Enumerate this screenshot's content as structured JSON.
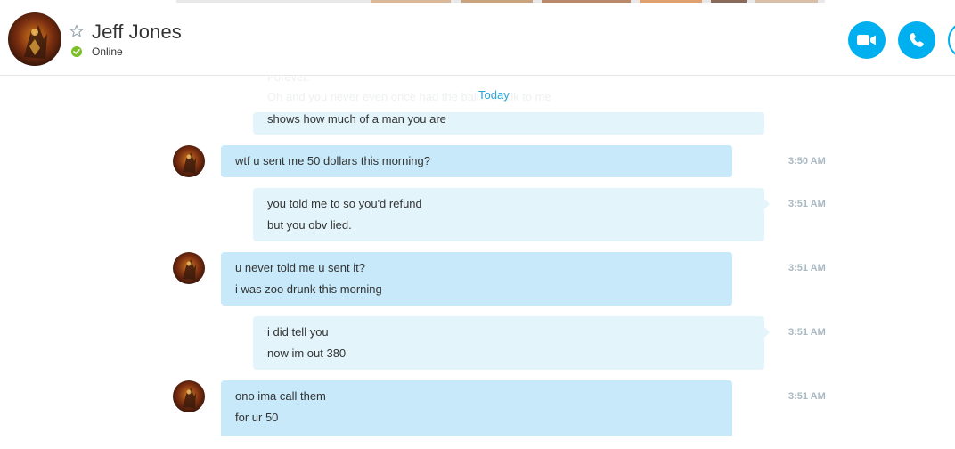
{
  "header": {
    "contact_name": "Jeff Jones",
    "status": "Online",
    "status_color": "#7cc028",
    "avatar_icon": "avatar-image",
    "favorite_icon": "star-icon",
    "buttons": [
      {
        "name": "video-call-button",
        "icon": "video-camera-icon"
      },
      {
        "name": "audio-call-button",
        "icon": "phone-icon"
      },
      {
        "name": "add-people-button",
        "icon": "add-icon"
      }
    ]
  },
  "chat": {
    "faded_lines": [
      "Forever.",
      "Oh and you never even once had the balls to talk to me"
    ],
    "date_divider": "Today",
    "messages": [
      {
        "direction": "out",
        "lines": [
          "shows how much of a man you are"
        ],
        "time": ""
      },
      {
        "direction": "in",
        "lines": [
          "wtf u sent me 50 dollars this morning?"
        ],
        "time": "3:50 AM"
      },
      {
        "direction": "out",
        "lines": [
          "you told me to so you'd refund",
          "but you obv lied."
        ],
        "time": "3:51 AM"
      },
      {
        "direction": "in",
        "lines": [
          "u never told me u sent it?",
          "i was zoo drunk this morning"
        ],
        "time": "3:51 AM"
      },
      {
        "direction": "out",
        "lines": [
          "i did tell you",
          "now im out 380"
        ],
        "time": "3:51 AM"
      },
      {
        "direction": "in",
        "lines": [
          "ono ima call them",
          "for ur 50"
        ],
        "time": "3:51 AM"
      }
    ]
  },
  "colors": {
    "accent": "#00aff0",
    "incoming_bubble": "#c7e9f9",
    "outgoing_bubble": "#e3f4fb",
    "timestamp": "#a9b8c2"
  }
}
